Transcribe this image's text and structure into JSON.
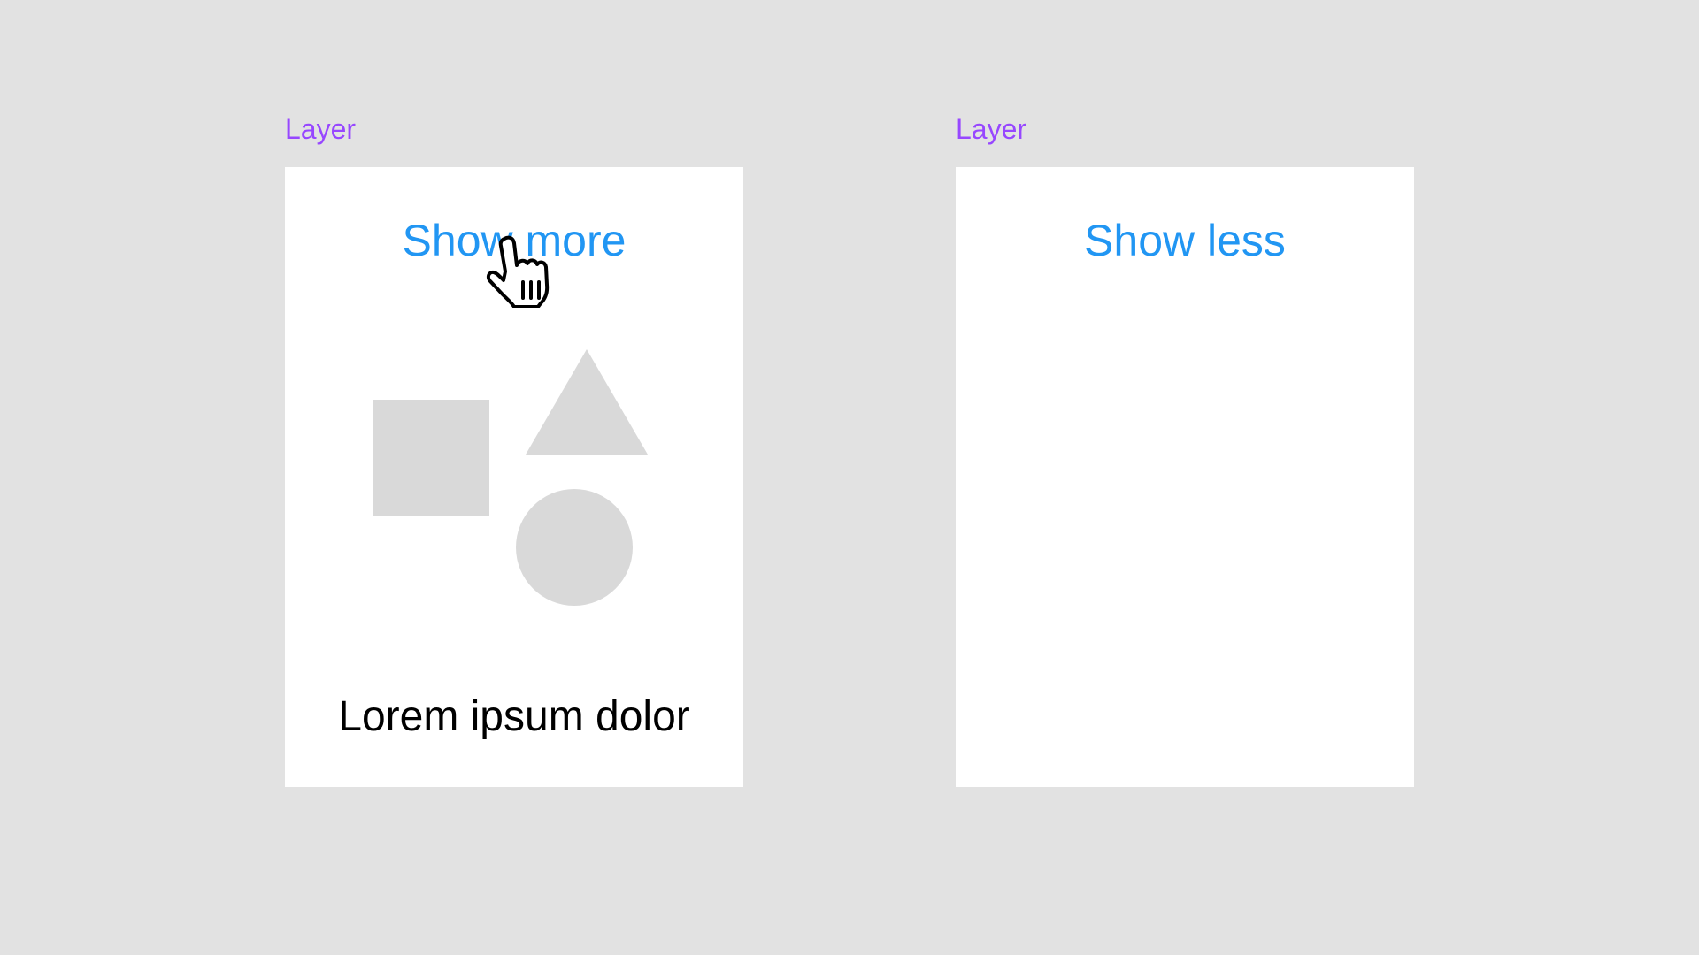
{
  "colors": {
    "canvas": "#e2e2e2",
    "frame": "#ffffff",
    "layer_label": "#9747ff",
    "link": "#2196f3",
    "shape": "#d9d9d9",
    "body_text": "#000000"
  },
  "left_frame": {
    "layer_label": "Layer",
    "toggle_label": "Show more",
    "body_text": "Lorem ipsum dolor",
    "shapes": [
      "square",
      "triangle",
      "circle"
    ]
  },
  "right_frame": {
    "layer_label": "Layer",
    "toggle_label": "Show less"
  },
  "cursor": {
    "icon": "hand-pointer-icon"
  }
}
